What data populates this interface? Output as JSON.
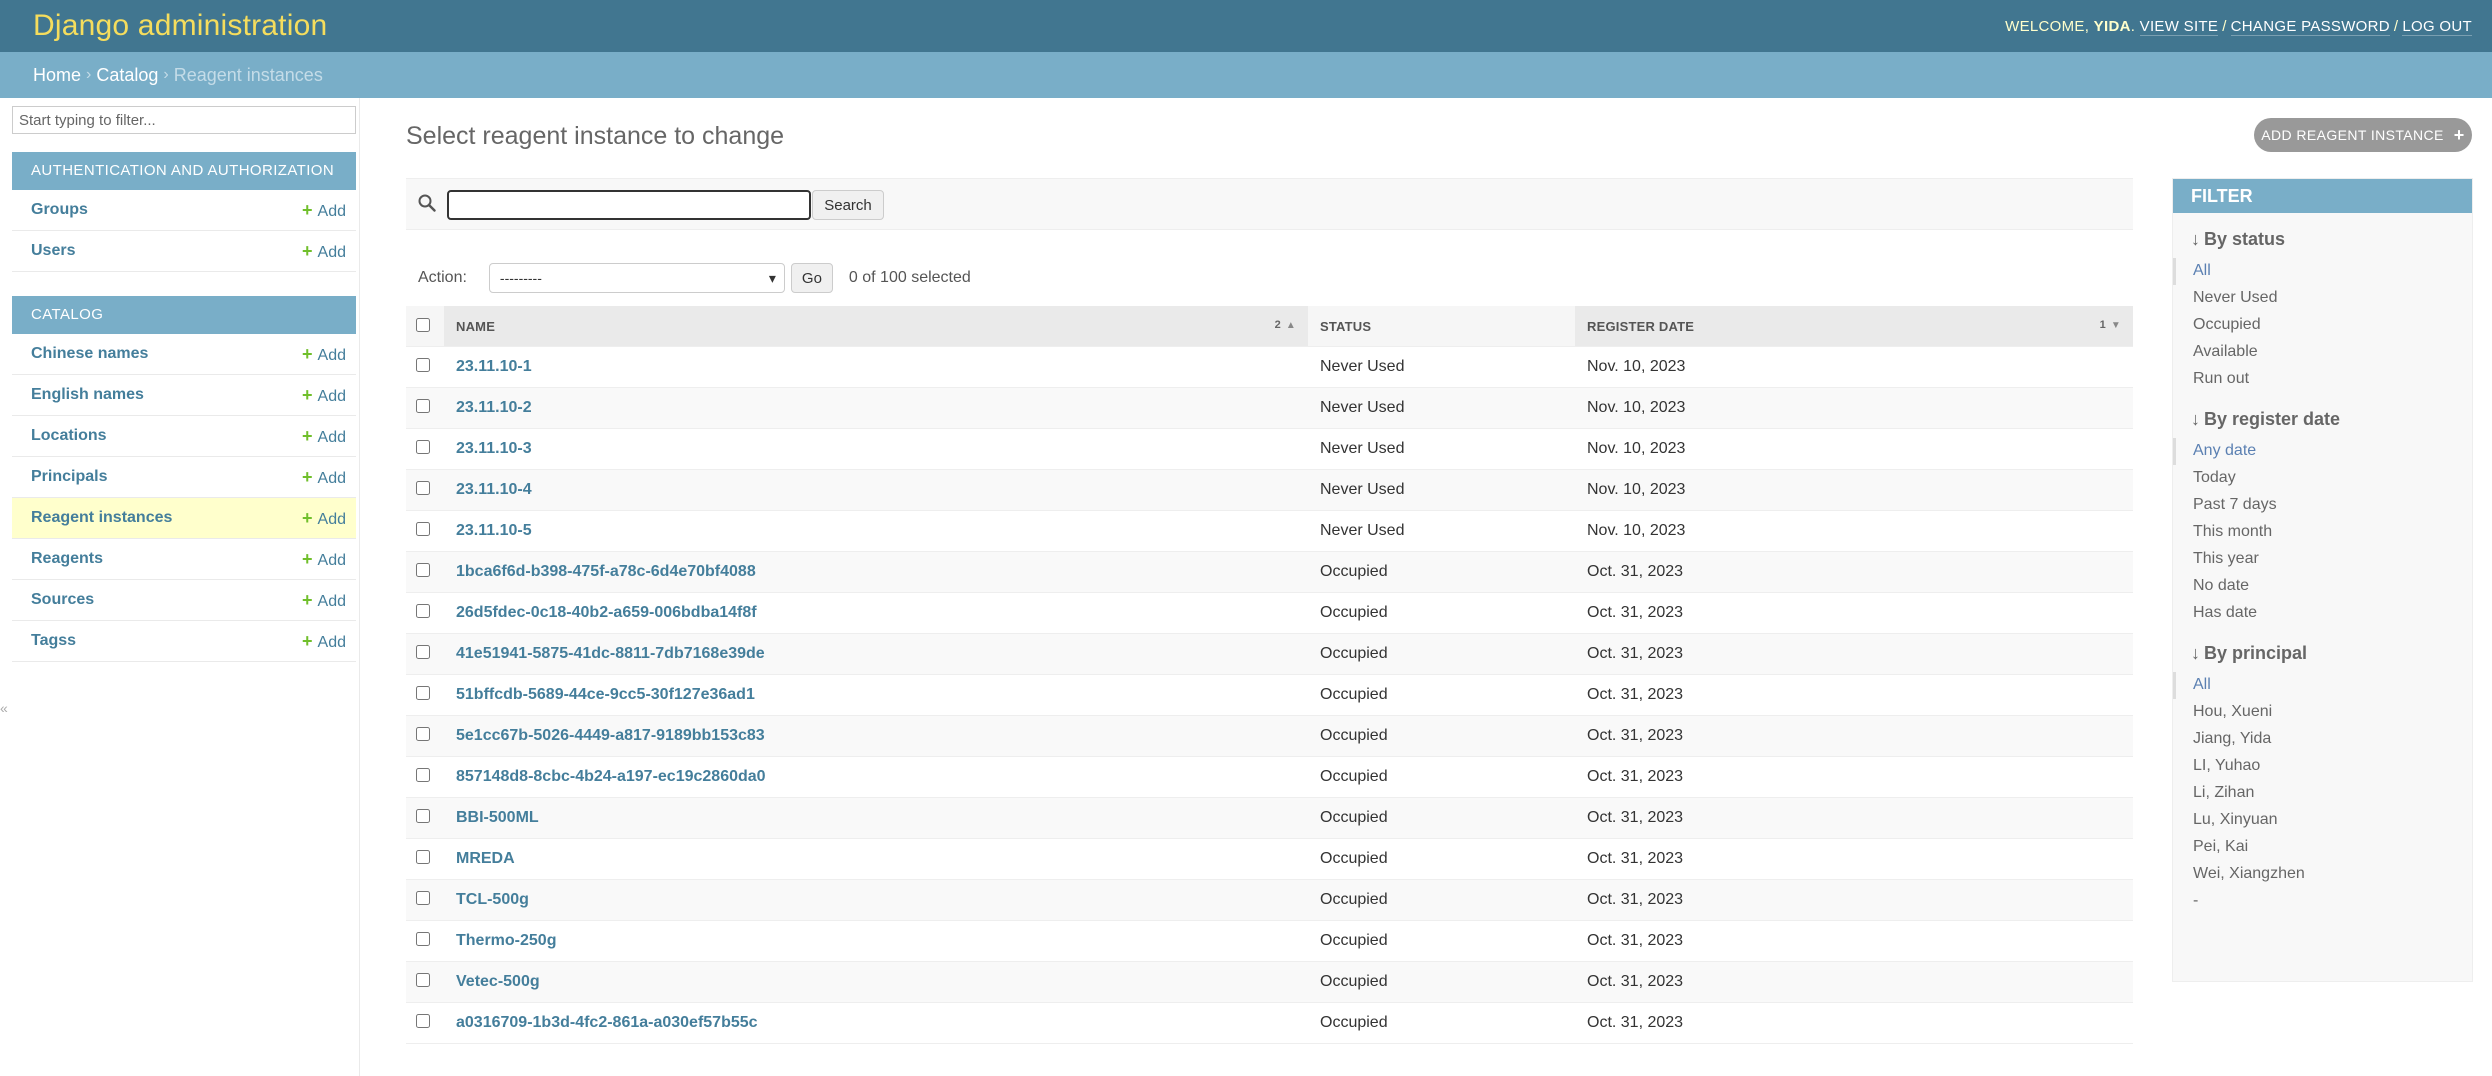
{
  "header": {
    "branding": "Django administration",
    "welcome": "Welcome,",
    "username": "yida",
    "links": [
      "View site",
      "Change password",
      "Log out"
    ]
  },
  "breadcrumbs": [
    "Home",
    "Catalog",
    "Reagent instances"
  ],
  "sidebar": {
    "filter_placeholder": "Start typing to filter...",
    "add_label": "Add",
    "collapse_glyph": "«",
    "modules": [
      {
        "caption": "Authentication and Authorization",
        "models": [
          "Groups",
          "Users"
        ]
      },
      {
        "caption": "Catalog",
        "models": [
          "Chinese names",
          "English names",
          "Locations",
          "Principals",
          "Reagent instances",
          "Reagents",
          "Sources",
          "Tagss"
        ],
        "current": "Reagent instances"
      }
    ]
  },
  "main": {
    "title": "Select reagent instance to change",
    "add_button": "Add reagent instance",
    "search_button": "Search",
    "search_value": "",
    "action_label": "Action:",
    "action_selected": "---------",
    "go_button": "Go",
    "action_counter": "0 of 100 selected"
  },
  "table": {
    "columns": [
      {
        "label": "Name",
        "sort_priority": "2",
        "sort_dir": "asc"
      },
      {
        "label": "Status"
      },
      {
        "label": "Register date",
        "sort_priority": "1",
        "sort_dir": "desc"
      }
    ],
    "rows": [
      {
        "name": "23.11.10-1",
        "status": "Never Used",
        "date": "Nov. 10, 2023"
      },
      {
        "name": "23.11.10-2",
        "status": "Never Used",
        "date": "Nov. 10, 2023"
      },
      {
        "name": "23.11.10-3",
        "status": "Never Used",
        "date": "Nov. 10, 2023"
      },
      {
        "name": "23.11.10-4",
        "status": "Never Used",
        "date": "Nov. 10, 2023"
      },
      {
        "name": "23.11.10-5",
        "status": "Never Used",
        "date": "Nov. 10, 2023"
      },
      {
        "name": "1bca6f6d-b398-475f-a78c-6d4e70bf4088",
        "status": "Occupied",
        "date": "Oct. 31, 2023"
      },
      {
        "name": "26d5fdec-0c18-40b2-a659-006bdba14f8f",
        "status": "Occupied",
        "date": "Oct. 31, 2023"
      },
      {
        "name": "41e51941-5875-41dc-8811-7db7168e39de",
        "status": "Occupied",
        "date": "Oct. 31, 2023"
      },
      {
        "name": "51bffcdb-5689-44ce-9cc5-30f127e36ad1",
        "status": "Occupied",
        "date": "Oct. 31, 2023"
      },
      {
        "name": "5e1cc67b-5026-4449-a817-9189bb153c83",
        "status": "Occupied",
        "date": "Oct. 31, 2023"
      },
      {
        "name": "857148d8-8cbc-4b24-a197-ec19c2860da0",
        "status": "Occupied",
        "date": "Oct. 31, 2023"
      },
      {
        "name": "BBI-500ML",
        "status": "Occupied",
        "date": "Oct. 31, 2023"
      },
      {
        "name": "MREDA",
        "status": "Occupied",
        "date": "Oct. 31, 2023"
      },
      {
        "name": "TCL-500g",
        "status": "Occupied",
        "date": "Oct. 31, 2023"
      },
      {
        "name": "Thermo-250g",
        "status": "Occupied",
        "date": "Oct. 31, 2023"
      },
      {
        "name": "Vetec-500g",
        "status": "Occupied",
        "date": "Oct. 31, 2023"
      },
      {
        "name": "a0316709-1b3d-4fc2-861a-a030ef57b55c",
        "status": "Occupied",
        "date": "Oct. 31, 2023"
      }
    ]
  },
  "filter": {
    "heading": "Filter",
    "groups": [
      {
        "title": "By status",
        "choices": [
          "All",
          "Never Used",
          "Occupied",
          "Available",
          "Run out"
        ],
        "selected": "All"
      },
      {
        "title": "By register date",
        "choices": [
          "Any date",
          "Today",
          "Past 7 days",
          "This month",
          "This year",
          "No date",
          "Has date"
        ],
        "selected": "Any date"
      },
      {
        "title": "By principal",
        "choices": [
          "All",
          "Hou, Xueni",
          "Jiang, Yida",
          "LI, Yuhao",
          "Li, Zihan",
          "Lu, Xinyuan",
          "Pei, Kai",
          "Wei, Xiangzhen",
          "-"
        ],
        "selected": "All"
      }
    ]
  },
  "colors": {
    "header_bg": "#417690",
    "branding": "#f5dd5d",
    "breadcrumbs_bg": "#79aec8",
    "link": "#447e9b",
    "add_plus": "#70bf2b",
    "current_row": "#ffffcc"
  }
}
